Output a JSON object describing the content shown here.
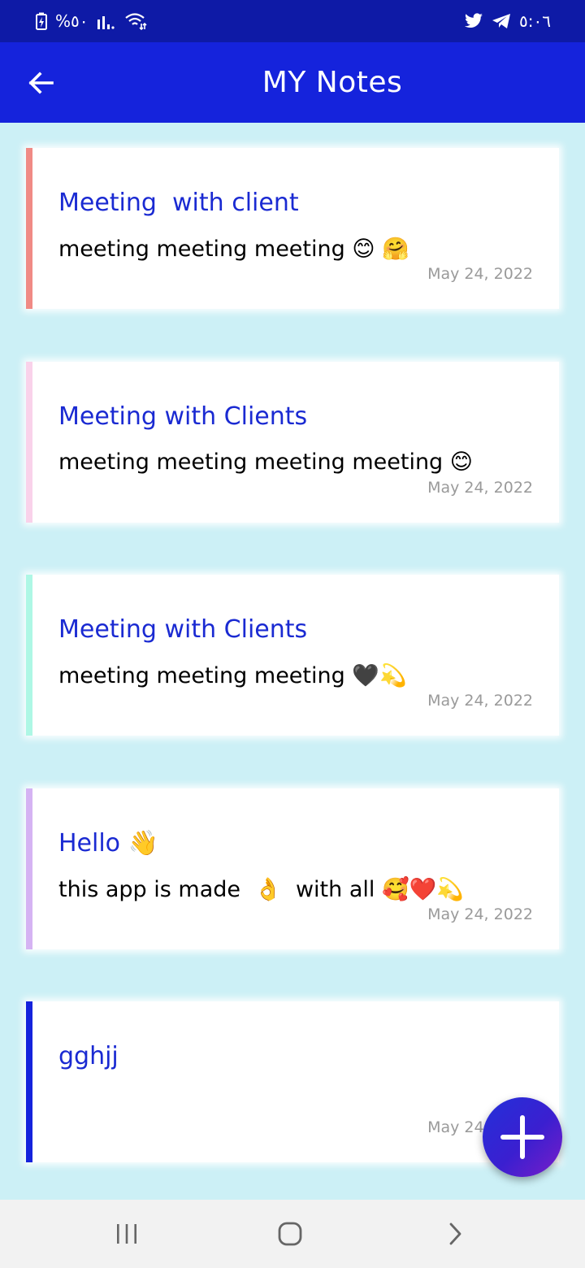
{
  "status_bar": {
    "left_text": "%٥٠",
    "time": "٥:٠٦",
    "icons": [
      "battery-charging-icon",
      "signal-icon",
      "wifi-icon",
      "twitter-icon",
      "telegram-icon"
    ]
  },
  "app_bar": {
    "title": "MY Notes",
    "back_icon": "arrow-left-icon"
  },
  "notes": [
    {
      "title": "Meeting  with client",
      "body": "meeting meeting meeting 😊 🤗",
      "date": "May 24, 2022",
      "accent": "#f08a85"
    },
    {
      "title": "Meeting with Clients",
      "body": "meeting meeting meeting meeting 😊",
      "date": "May 24, 2022",
      "accent": "#f9d2ea"
    },
    {
      "title": "Meeting with Clients",
      "body": "meeting meeting meeting 🖤💫",
      "date": "May 24, 2022",
      "accent": "#aef7e5"
    },
    {
      "title": "Hello 👋",
      "body": "this app is made  👌  with all 🥰❤️💫",
      "date": "May 24, 2022",
      "accent": "#d5b3f3"
    },
    {
      "title": "gghjj",
      "body": "",
      "date": "May 24, 2022",
      "accent": "#1523dc"
    }
  ],
  "fab": {
    "icon": "plus-icon"
  },
  "nav_bar": {
    "icons": [
      "recent-apps-icon",
      "home-icon",
      "back-chevron-icon"
    ]
  },
  "colors": {
    "status_bar": "#0e1aa6",
    "app_bar": "#1523dc",
    "background": "#ccf0f6",
    "title_text": "#1a2ad2"
  }
}
